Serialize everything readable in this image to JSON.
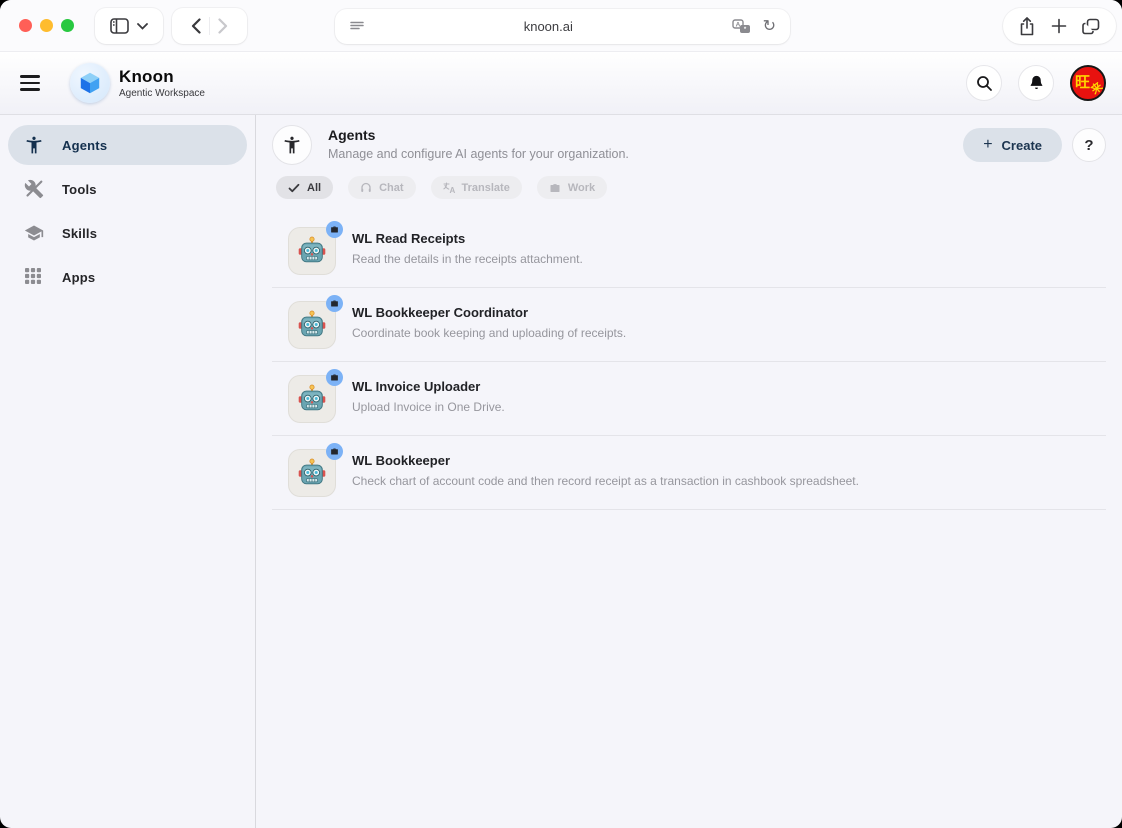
{
  "browser": {
    "url": "knoon.ai",
    "traffic_lights": {
      "close": "#ff5f57",
      "minimize": "#febc2e",
      "zoom": "#28c840"
    }
  },
  "header": {
    "app_name": "Knoon",
    "app_subtitle": "Agentic Workspace",
    "avatar_char_1": "旺",
    "avatar_char_2": "来"
  },
  "sidebar": {
    "items": [
      {
        "label": "Agents",
        "icon": "accessibility-person-icon",
        "active": true
      },
      {
        "label": "Tools",
        "icon": "tools-icon",
        "active": false
      },
      {
        "label": "Skills",
        "icon": "graduation-cap-icon",
        "active": false
      },
      {
        "label": "Apps",
        "icon": "apps-grid-icon",
        "active": false
      }
    ]
  },
  "page": {
    "title": "Agents",
    "description": "Manage and configure AI agents for your organization.",
    "create_label": "Create",
    "create_plus": "+",
    "help_label": "?",
    "filters": [
      {
        "label": "All",
        "icon": "check-icon",
        "active": true
      },
      {
        "label": "Chat",
        "icon": "headset-icon",
        "active": false
      },
      {
        "label": "Translate",
        "icon": "translate-icon",
        "active": false
      },
      {
        "label": "Work",
        "icon": "briefcase-icon",
        "active": false
      }
    ],
    "agents": [
      {
        "name": "WL Read Receipts",
        "description": "Read the details in the receipts attachment.",
        "avatar": "robot-emoji",
        "badge": "briefcase-icon"
      },
      {
        "name": "WL Bookkeeper Coordinator",
        "description": "Coordinate book keeping and uploading of receipts.",
        "avatar": "robot-emoji",
        "badge": "briefcase-icon"
      },
      {
        "name": "WL Invoice Uploader",
        "description": "Upload Invoice in One Drive.",
        "avatar": "robot-emoji",
        "badge": "briefcase-icon"
      },
      {
        "name": "WL Bookkeeper",
        "description": "Check chart of account code and then record receipt as a transaction in cashbook spreadsheet.",
        "avatar": "robot-emoji",
        "badge": "briefcase-icon"
      }
    ]
  },
  "colors": {
    "accent_pill": "#dbe1e9",
    "accent_text": "#14304e",
    "badge_blue": "#7cb2f6",
    "avatar_red": "#e8120f",
    "avatar_yellow": "#ffd400",
    "page_bg": "#f5f5fa"
  }
}
